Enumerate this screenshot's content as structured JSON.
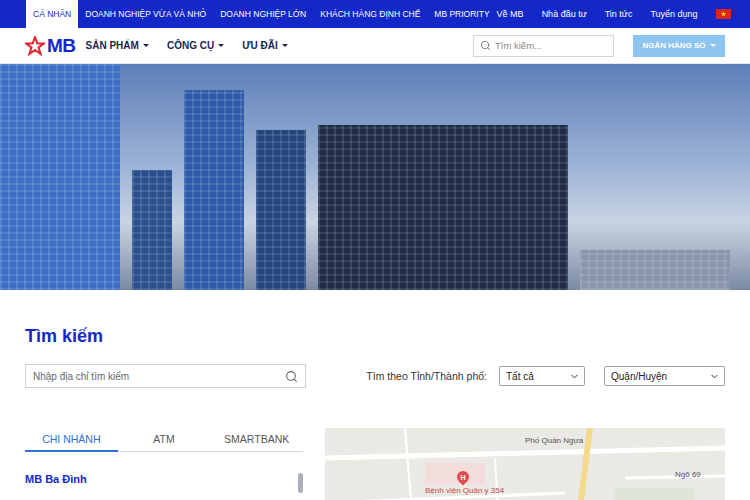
{
  "top_bar": {
    "segments": [
      {
        "label": "CÁ NHÂN",
        "selected": true
      },
      {
        "label": "DOANH NGHIỆP VỪA VÀ NHỎ",
        "selected": false
      },
      {
        "label": "DOANH NGHIỆP LỚN",
        "selected": false
      },
      {
        "label": "KHÁCH HÀNG ĐỊNH CHẾ",
        "selected": false
      },
      {
        "label": "MB PRIORITY",
        "selected": false
      }
    ],
    "links": [
      "Về MB",
      "Nhà đầu tư",
      "Tin tức",
      "Tuyển dụng"
    ]
  },
  "header": {
    "logo": "MB",
    "menu": [
      "SẢN PHẨM",
      "CÔNG CỤ",
      "ƯU ĐÃI"
    ],
    "search": {
      "placeholder": "Tìm kiếm..."
    },
    "digital_button": "NGÂN HÀNG SỐ"
  },
  "finder": {
    "title": "Tìm kiếm",
    "address": {
      "placeholder": "Nhập địa chỉ tìm kiếm"
    },
    "province_label": "Tìm theo Tỉnh/Thành phố:",
    "province": "Tất cả",
    "district": "Quận/Huyện",
    "tabs": [
      {
        "label": "CHI NHÁNH",
        "selected": true
      },
      {
        "label": "ATM",
        "selected": false
      },
      {
        "label": "SMARTBANK",
        "selected": false
      }
    ],
    "branches": [
      {
        "name": "MB Ba Đình"
      }
    ],
    "map": {
      "labels": [
        "Phố Quán Ngựa",
        "Ngõ 69",
        "Bệnh viện Quân y 354"
      ],
      "pin": "H"
    }
  }
}
